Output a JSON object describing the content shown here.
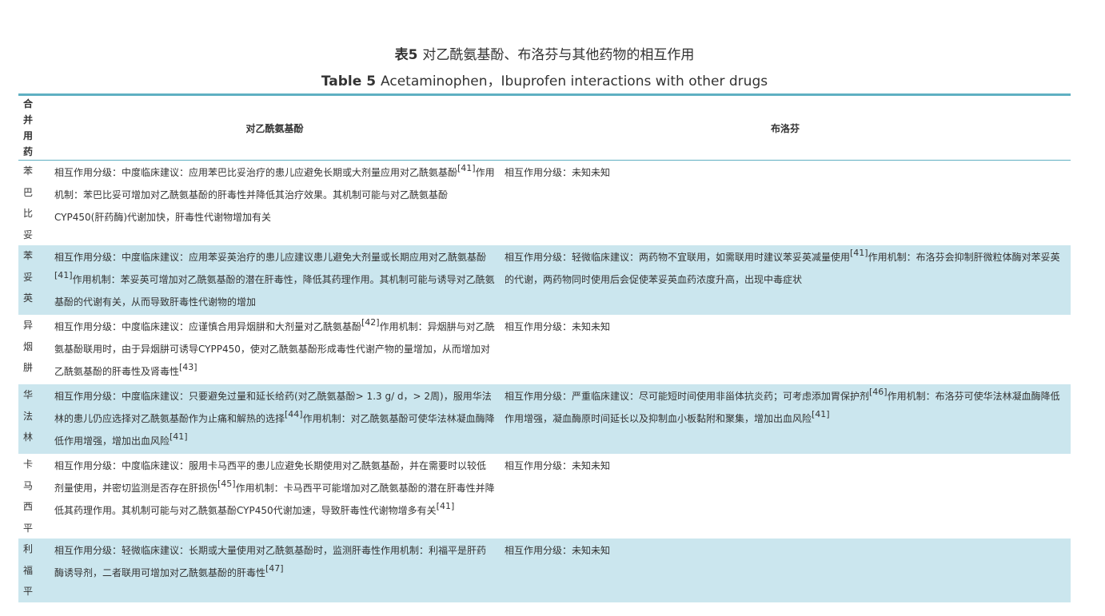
{
  "title": {
    "cn_label": "表5",
    "cn_text": "对乙酰氨基酚、布洛芬与其他药物的相互作用",
    "en_label": "Table 5",
    "en_text": "Acetaminophen，Ibuprofen interactions with other drugs"
  },
  "columns": [
    "合并用药",
    "对乙酰氨基酚",
    "布洛芬"
  ],
  "rows": [
    {
      "drug": "苯巴比妥",
      "acetaminophen": [
        {
          "t": "相互作用分级：中度临床建议：应用苯巴比妥治疗的患儿应避免长期或大剂量应用对乙酰氨基酚"
        },
        {
          "sup": "[41]"
        },
        {
          "t": "作用机制：苯巴比妥可增加对乙酰氨基酚的肝毒性并降低其治疗效果。其机制可能与对乙酰氨基酚CYP450(肝药酶)代谢加快，肝毒性代谢物增加有关"
        }
      ],
      "ibuprofen": [
        {
          "t": "相互作用分级：未知未知"
        }
      ]
    },
    {
      "drug": "苯妥英",
      "acetaminophen": [
        {
          "t": "相互作用分级：中度临床建议：应用苯妥英治疗的患儿应建议患儿避免大剂量或长期应用对乙酰氨基酚"
        },
        {
          "sup": "[41]"
        },
        {
          "t": "作用机制：苯妥英可增加对乙酰氨基酚的潜在肝毒性，降低其药理作用。其机制可能与诱导对乙酰氨基酚的代谢有关，从而导致肝毒性代谢物的增加"
        }
      ],
      "ibuprofen": [
        {
          "t": "相互作用分级：轻微临床建议：两药物不宜联用，如需联用时建议苯妥英减量使用"
        },
        {
          "sup": "[41]"
        },
        {
          "t": "作用机制：布洛芬会抑制肝微粒体酶对苯妥英的代谢，两药物同时使用后会促使苯妥英血药浓度升高，出现中毒症状"
        }
      ]
    },
    {
      "drug": "异烟肼",
      "acetaminophen": [
        {
          "t": "相互作用分级：中度临床建议：应谨慎合用异烟肼和大剂量对乙酰氨基酚"
        },
        {
          "sup": "[42]"
        },
        {
          "t": "作用机制：异烟肼与对乙酰氨基酚联用时，由于异烟肼可诱导CYPP450，使对乙酰氨基酚形成毒性代谢产物的量增加，从而增加对乙酰氨基酚的肝毒性及肾毒性"
        },
        {
          "sup": "[43]"
        }
      ],
      "ibuprofen": [
        {
          "t": "相互作用分级：未知未知"
        }
      ]
    },
    {
      "drug": "华法林",
      "acetaminophen": [
        {
          "t": "相互作用分级：中度临床建议：只要避免过量和延长给药(对乙酰氨基酚> 1.3 g/ d，> 2周)，服用华法林的患儿仍应选择对乙酰氨基酚作为止痛和解热的选择"
        },
        {
          "sup": "[44]"
        },
        {
          "t": "作用机制：对乙酰氨基酚可使华法林凝血酶降低作用增强，增加出血风险"
        },
        {
          "sup": "[41]"
        }
      ],
      "ibuprofen": [
        {
          "t": "相互作用分级：严重临床建议：尽可能短时间使用非甾体抗炎药；可考虑添加胃保护剂"
        },
        {
          "sup": "[46]"
        },
        {
          "t": "作用机制：布洛芬可使华法林凝血酶降低作用增强，凝血酶原时间延长以及抑制血小板黏附和聚集，增加出血风险"
        },
        {
          "sup": "[41]"
        }
      ]
    },
    {
      "drug": "卡马西平",
      "acetaminophen": [
        {
          "t": "相互作用分级：中度临床建议：服用卡马西平的患儿应避免长期使用对乙酰氨基酚，并在需要时以较低剂量使用，并密切监测是否存在肝损伤"
        },
        {
          "sup": "[45]"
        },
        {
          "t": "作用机制：卡马西平可能增加对乙酰氨基酚的潜在肝毒性并降低其药理作用。其机制可能与对乙酰氨基酚CYP450代谢加速，导致肝毒性代谢物增多有关"
        },
        {
          "sup": "[41]"
        }
      ],
      "ibuprofen": [
        {
          "t": "相互作用分级：未知未知"
        }
      ]
    },
    {
      "drug": "利福平",
      "acetaminophen": [
        {
          "t": "相互作用分级：轻微临床建议：长期或大量使用对乙酰氨基酚时，监测肝毒性作用机制：利福平是肝药酶诱导剂，二者联用可增加对乙酰氨基酚的肝毒性"
        },
        {
          "sup": "[47]"
        }
      ],
      "ibuprofen": [
        {
          "t": "相互作用分级：未知未知"
        }
      ]
    }
  ]
}
